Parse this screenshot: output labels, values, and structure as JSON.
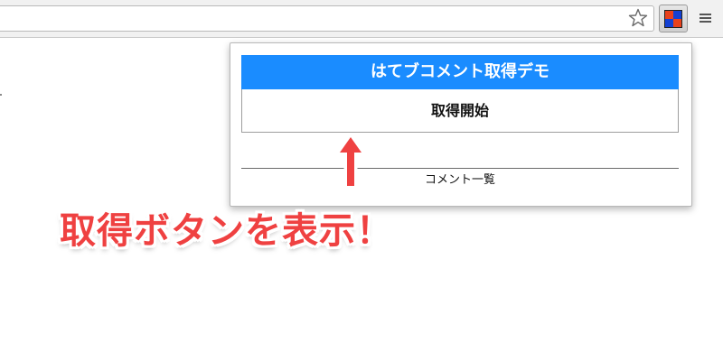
{
  "browser": {
    "icons": [
      "star-icon",
      "extension-icon",
      "menu-icon"
    ]
  },
  "popup": {
    "header_title": "はてブコメント取得デモ",
    "fetch_button_label": "取得開始",
    "comment_list_label": "コメント一覧"
  },
  "annotation": {
    "text": "取得ボタンを表示！",
    "color": "#ef4141"
  },
  "colors": {
    "header_bg": "#1a8cff",
    "annotation_red": "#ef4141",
    "ext_icon_red": "#e8411c",
    "ext_icon_blue": "#1340d3"
  }
}
